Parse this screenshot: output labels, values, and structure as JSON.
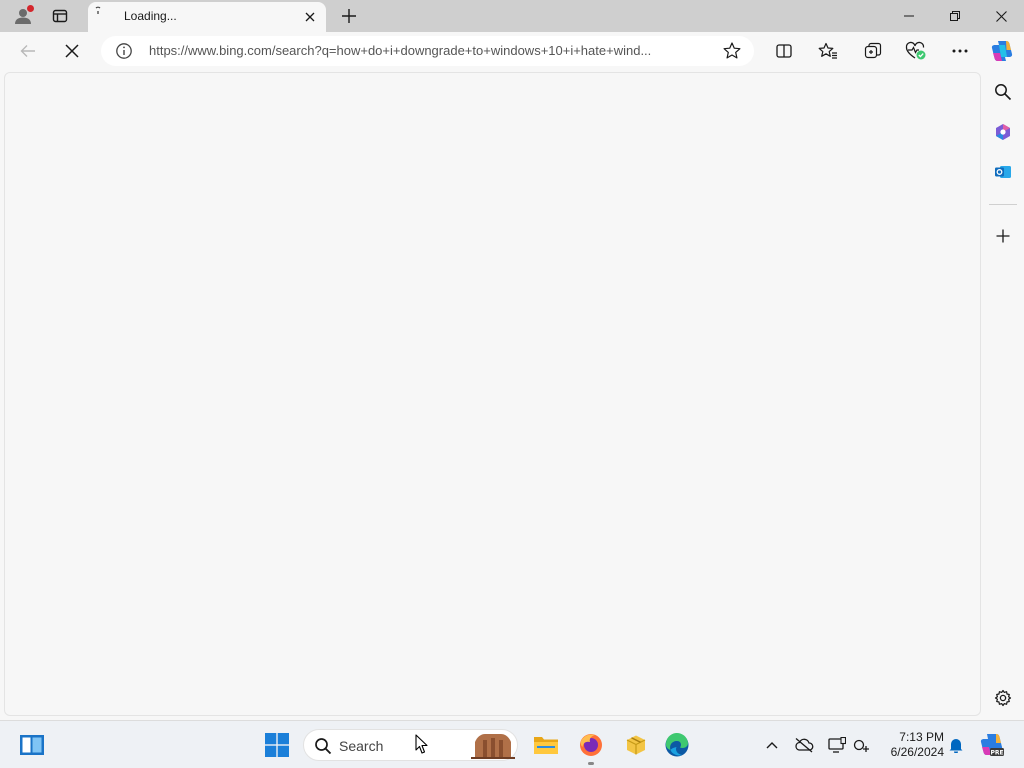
{
  "browser": {
    "tab": {
      "title": "Loading..."
    },
    "address": {
      "url": "https://www.bing.com/search?q=how+do+i+downgrade+to+windows+10+i+hate+wind..."
    }
  },
  "icons": {
    "profile": "profile-icon",
    "tab_actions": "tab-actions-icon",
    "new_tab": "plus-icon",
    "back": "arrow-left-icon",
    "stop": "close-icon",
    "info": "info-icon",
    "favorite": "star-icon",
    "split_screen": "split-screen-icon",
    "favorites": "favorites-icon",
    "collections": "collections-icon",
    "browser_essentials": "heart-pulse-icon",
    "more": "more-icon",
    "copilot": "copilot-icon",
    "search": "search-icon",
    "m365": "microsoft-365-icon",
    "outlook": "outlook-icon",
    "settings": "gear-icon"
  },
  "taskbar": {
    "search_placeholder": "Search",
    "time": "7:13 PM",
    "date": "6/26/2024"
  },
  "colors": {
    "accent": "#0067c0",
    "notification_dot": "#d4262c",
    "edge_blue": "#0c59a4",
    "edge_green": "#3ec870"
  }
}
